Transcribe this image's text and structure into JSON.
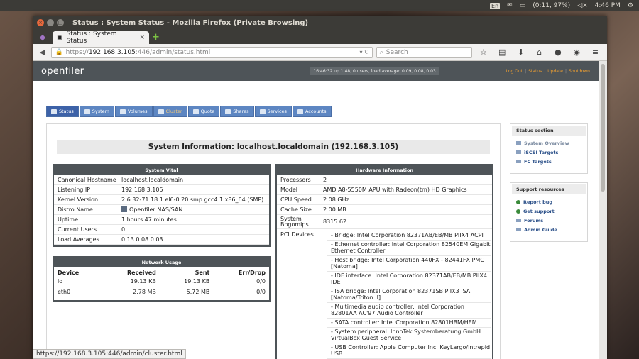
{
  "topbar": {
    "lang": "En",
    "battery": "(0:11, 97%)",
    "time": "4:46 PM"
  },
  "window": {
    "title": "Status : System Status - Mozilla Firefox (Private Browsing)"
  },
  "tab": {
    "label": "Status : System Status",
    "close": "×",
    "new": "+"
  },
  "nav": {
    "url_prefix": "https://",
    "url_host": "192.168.3.105",
    "url_rest": ":446/admin/status.html",
    "search_placeholder": "Search"
  },
  "header": {
    "logo": "openfiler",
    "uptime": "16:46:32 up 1:48, 0 users, load average: 0.09, 0.08, 0.03",
    "links": [
      "Log Out",
      "Status",
      "Update",
      "Shutdown"
    ]
  },
  "menu": [
    "Status",
    "System",
    "Volumes",
    "Cluster",
    "Quota",
    "Shares",
    "Services",
    "Accounts"
  ],
  "system_title": "System Information: localhost.localdomain (192.168.3.105)",
  "system_vital": {
    "title": "System Vital",
    "rows": [
      {
        "k": "Canonical Hostname",
        "v": "localhost.localdomain"
      },
      {
        "k": "Listening IP",
        "v": "192.168.3.105"
      },
      {
        "k": "Kernel Version",
        "v": "2.6.32-71.18.1.el6-0.20.smp.gcc4.1.x86_64 (SMP)"
      },
      {
        "k": "Distro Name",
        "v": "Openfiler NAS/SAN"
      },
      {
        "k": "Uptime",
        "v": "1 hours 47 minutes"
      },
      {
        "k": "Current Users",
        "v": "0"
      },
      {
        "k": "Load Averages",
        "v": "0.13 0.08 0.03"
      }
    ]
  },
  "network": {
    "title": "Network Usage",
    "headers": [
      "Device",
      "Received",
      "Sent",
      "Err/Drop"
    ],
    "rows": [
      [
        "lo",
        "19.13 KB",
        "19.13 KB",
        "0/0"
      ],
      [
        "eth0",
        "2.78 MB",
        "5.72 MB",
        "0/0"
      ]
    ]
  },
  "hardware": {
    "title": "Hardware Information",
    "rows": [
      {
        "k": "Processors",
        "v": "2"
      },
      {
        "k": "Model",
        "v": "AMD A8-5550M APU with Radeon(tm) HD Graphics"
      },
      {
        "k": "CPU Speed",
        "v": "2.08 GHz"
      },
      {
        "k": "Cache Size",
        "v": "2.00 MB"
      },
      {
        "k": "System Bogomips",
        "v": "8315.62"
      }
    ],
    "pci_label": "PCI Devices",
    "pci": [
      "- Bridge: Intel Corporation 82371AB/EB/MB PIIX4 ACPI",
      "- Ethernet controller: Intel Corporation 82540EM Gigabit Ethernet Controller",
      "- Host bridge: Intel Corporation 440FX - 82441FX PMC [Natoma]",
      "- IDE interface: Intel Corporation 82371AB/EB/MB PIIX4 IDE",
      "- ISA bridge: Intel Corporation 82371SB PIIX3 ISA [Natoma/Triton II]",
      "- Multimedia audio controller: Intel Corporation 82801AA AC'97 Audio Controller",
      "- SATA controller: Intel Corporation 82801HBM/HEM",
      "- System peripheral: InnoTek Systemberatung GmbH VirtualBox Guest Service",
      "- USB Controller: Apple Computer Inc. KeyLargo/Intrepid USB"
    ]
  },
  "status_section": {
    "title": "Status section",
    "items": [
      "System Overview",
      "iSCSI Targets",
      "FC Targets"
    ]
  },
  "support": {
    "title": "Support resources",
    "items": [
      "Report bug",
      "Get support",
      "Forums",
      "Admin Guide"
    ]
  },
  "statusbar": "https://192.168.3.105:446/admin/cluster.html"
}
